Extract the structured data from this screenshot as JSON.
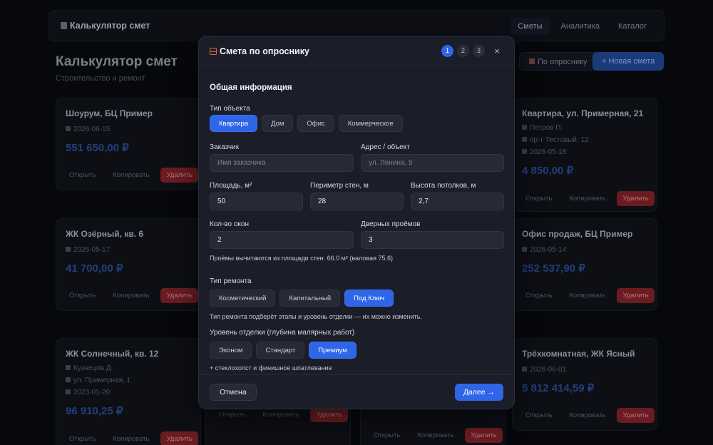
{
  "app": {
    "brand": "Калькулятор смет",
    "nav": [
      "Сметы",
      "Аналитика",
      "Каталог"
    ],
    "page_title": "Калькулятор смет",
    "page_subtitle": "Строительство и ремонт",
    "btn_questionnaire": "По опроснику",
    "btn_new": "+ Новая смета",
    "card_actions": {
      "open": "Открыть",
      "copy": "Копировать",
      "delete": "Удалить"
    },
    "cards": [
      {
        "title": "Шоурум, БЦ Пример",
        "date": "2026-06-15",
        "price": "551 650,00 ₽"
      },
      {
        "title": "ЖК Озёрный, кв. 6",
        "date": "2026-05-17",
        "price": "41 700,00 ₽"
      },
      {
        "title": "ЖК Солнечный, кв. 12",
        "client": "Кузнецов Д.",
        "address": "ул. Примерная, 1",
        "date": "2023-01-20",
        "price": "96 910,25 ₽"
      },
      {
        "title": "Квартира, ул. Примерная, 21",
        "client": "Петров П.",
        "address": "пр-т Тестовый, 12",
        "date": "2026-05-18",
        "price": "4 850,00 ₽"
      },
      {
        "title": "Офис продаж, БЦ Пример",
        "date": "2026-05-14",
        "price": "252 537,90 ₽"
      },
      {
        "title": "Трёхкомнатная, ЖК Ясный",
        "date": "2026-06-01",
        "price": "5 812 414,59 ₽"
      }
    ]
  },
  "modal": {
    "title": "Смета по опроснику",
    "steps": [
      "1",
      "2",
      "3"
    ],
    "close": "×",
    "section": "Общая информация",
    "object_type": {
      "label": "Тип объекта",
      "options": [
        "Квартира",
        "Дом",
        "Офис",
        "Коммерческое"
      ],
      "selected": "Квартира"
    },
    "client": {
      "label": "Заказчик",
      "placeholder": "Имя заказчика"
    },
    "address": {
      "label": "Адрес / объект",
      "placeholder": "ул. Ленина, 5"
    },
    "area": {
      "label": "Площадь, м²",
      "value": "50"
    },
    "perimeter": {
      "label": "Периметр стен, м",
      "value": "28"
    },
    "height": {
      "label": "Высота потолков, м",
      "value": "2,7"
    },
    "windows": {
      "label": "Кол-во окон",
      "value": "2"
    },
    "doors": {
      "label": "Дверных проёмов",
      "value": "3"
    },
    "openings_note": "Проёмы вычитаются из площади стен: 66.0 м² (валовая 75.6)",
    "repair_type": {
      "label": "Тип ремонта",
      "options": [
        "Косметический",
        "Капитальный",
        "Под Ключ"
      ],
      "selected": "Под Ключ"
    },
    "repair_note": "Тип ремонта подберёт этапы и уровень отделки — их можно изменить.",
    "finish_level": {
      "label": "Уровень отделки (глубина малярных работ)",
      "options": [
        "Эконом",
        "Стандарт",
        "Премиум"
      ],
      "selected": "Премиум"
    },
    "finish_note": "+ стеклохолст и финишное шпатлевание",
    "cancel": "Отмена",
    "next": "Далее →"
  }
}
